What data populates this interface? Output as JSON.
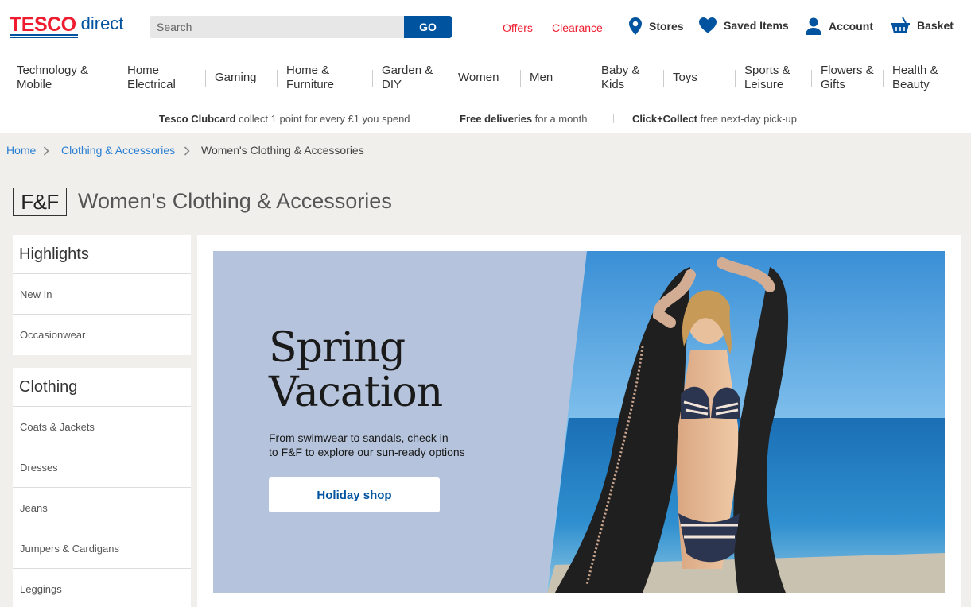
{
  "header": {
    "logo_brand": "TESCO",
    "logo_suffix": "direct",
    "search_placeholder": "Search",
    "search_button": "GO",
    "links": {
      "offers": "Offers",
      "clearance": "Clearance"
    },
    "tools": {
      "stores": "Stores",
      "saved": "Saved Items",
      "account": "Account",
      "basket": "Basket"
    }
  },
  "nav": {
    "items": [
      {
        "label": "Technology & Mobile",
        "line1": "Technology &",
        "line2": "Mobile"
      },
      {
        "label": "Home Electrical",
        "line1": "Home",
        "line2": "Electrical"
      },
      {
        "label": "Gaming",
        "line1": "Gaming",
        "line2": ""
      },
      {
        "label": "Home & Furniture",
        "line1": "Home &",
        "line2": "Furniture"
      },
      {
        "label": "Garden & DIY",
        "line1": "Garden &",
        "line2": "DIY"
      },
      {
        "label": "Women",
        "line1": "Women",
        "line2": ""
      },
      {
        "label": "Men",
        "line1": "Men",
        "line2": ""
      },
      {
        "label": "Baby & Kids",
        "line1": "Baby &",
        "line2": "Kids"
      },
      {
        "label": "Toys",
        "line1": "Toys",
        "line2": ""
      },
      {
        "label": "Sports & Leisure",
        "line1": "Sports &",
        "line2": "Leisure"
      },
      {
        "label": "Flowers & Gifts",
        "line1": "Flowers &",
        "line2": "Gifts"
      },
      {
        "label": "Health & Beauty",
        "line1": "Health &",
        "line2": "Beauty"
      }
    ]
  },
  "promo": [
    {
      "bold": "Tesco Clubcard",
      "text": " collect 1 point for every £1 you spend"
    },
    {
      "bold": "Free deliveries",
      "text": " for a month"
    },
    {
      "bold": "Click+Collect",
      "text": " free next-day pick-up"
    }
  ],
  "breadcrumb": {
    "home": "Home",
    "parent": "Clothing & Accessories",
    "current": "Women's Clothing & Accessories"
  },
  "page": {
    "brand_logo": "F&F",
    "title": "Women's Clothing & Accessories"
  },
  "sidebar": {
    "highlights": {
      "heading": "Highlights",
      "items": [
        "New In",
        "Occasionwear"
      ]
    },
    "clothing": {
      "heading": "Clothing",
      "items": [
        "Coats & Jackets",
        "Dresses",
        "Jeans",
        "Jumpers & Cardigans",
        "Leggings"
      ]
    }
  },
  "hero": {
    "title_line1": "Spring",
    "title_line2": "Vacation",
    "subtitle_line1": "From swimwear to sandals, check in",
    "subtitle_line2": "to F&F to explore our sun-ready options",
    "cta": "Holiday shop"
  },
  "colors": {
    "brand_red": "#ee1c2e",
    "brand_blue": "#00539f",
    "link_blue": "#2a7fd4",
    "hero_bg": "#b5c4dc",
    "page_bg": "#f0efeb"
  }
}
